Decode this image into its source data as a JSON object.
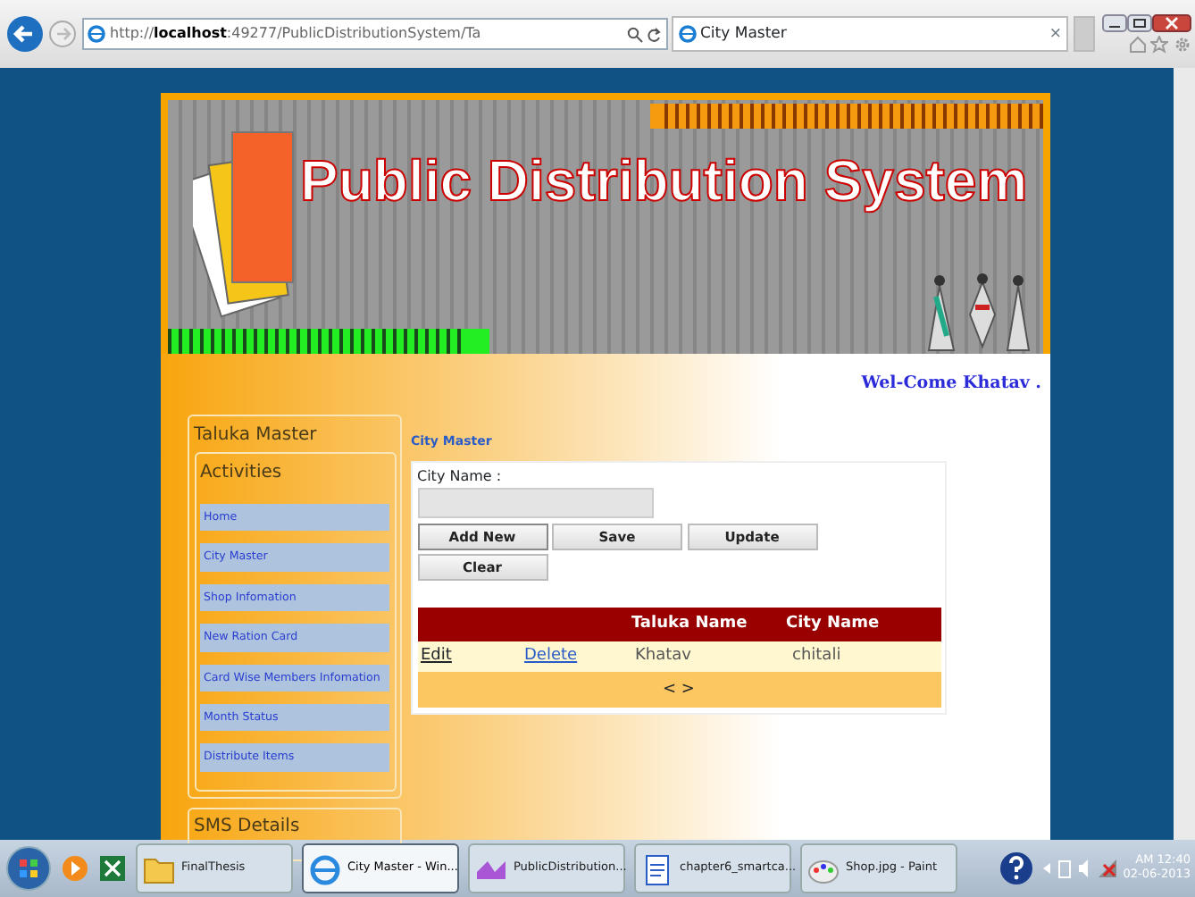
{
  "browser": {
    "address_prefix": "http://",
    "address_host": "localhost",
    "address_rest": ":49277/PublicDistributionSystem/Ta",
    "tab_title": "City Master",
    "tab_close": "×"
  },
  "banner": {
    "title": "Public Distribution System"
  },
  "welcome": "Wel-Come Khatav .",
  "sidebar": {
    "title": "Taluka Master",
    "activities_title": "Activities",
    "items": [
      {
        "label": "Home"
      },
      {
        "label": "City Master"
      },
      {
        "label": "Shop Infomation"
      },
      {
        "label": "New Ration Card"
      },
      {
        "label": "Card Wise Members Infomation"
      },
      {
        "label": "Month Status"
      },
      {
        "label": "Distribute Items"
      }
    ],
    "sms_title": "SMS Details"
  },
  "breadcrumb": "City Master",
  "form": {
    "label": "City Name :"
  },
  "buttons": [
    {
      "label": "Add New"
    },
    {
      "label": "Save"
    },
    {
      "label": "Update"
    },
    {
      "label": "Clear"
    }
  ],
  "table": {
    "columns": [
      "Taluka Name",
      "City Name"
    ],
    "rows": [
      {
        "edit": "Edit",
        "delete": "Delete",
        "taluka": "Khatav",
        "city": "chitali"
      }
    ],
    "pager": "< >"
  },
  "taskbar": {
    "items": [
      {
        "kind": "folder",
        "label": "FinalThesis",
        "selected": false
      },
      {
        "kind": "browser",
        "label": "City Master - Win...",
        "selected": true
      },
      {
        "kind": "studio",
        "label": "PublicDistribution...",
        "selected": false
      },
      {
        "kind": "document",
        "label": "chapter6_smartca...",
        "selected": false
      },
      {
        "kind": "paint",
        "label": "Shop.jpg - Paint",
        "selected": false
      }
    ],
    "time": "AM 12:40",
    "date": "02-06-2013"
  }
}
